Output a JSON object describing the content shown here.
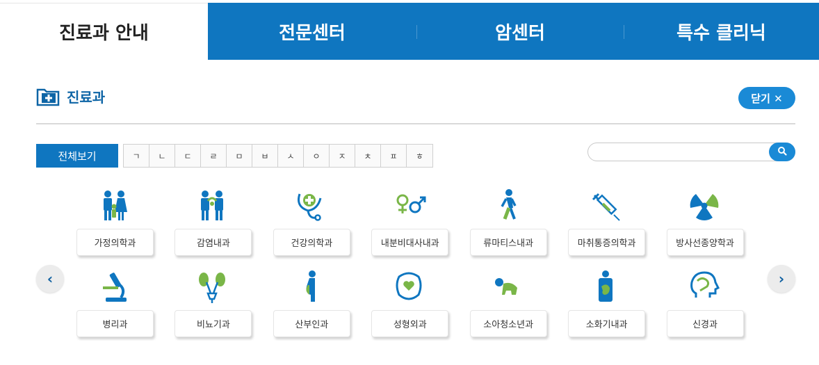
{
  "tabs": [
    {
      "label": "진료과 안내",
      "active": true
    },
    {
      "label": "전문센터",
      "active": false
    },
    {
      "label": "암센터",
      "active": false
    },
    {
      "label": "특수 클리닉",
      "active": false
    }
  ],
  "section": {
    "title": "진료과",
    "close_label": "닫기 ✕"
  },
  "filter": {
    "all_label": "전체보기",
    "consonants": [
      "ㄱ",
      "ㄴ",
      "ㄷ",
      "ㄹ",
      "ㅁ",
      "ㅂ",
      "ㅅ",
      "ㅇ",
      "ㅈ",
      "ㅊ",
      "ㅍ",
      "ㅎ"
    ]
  },
  "search": {
    "value": "",
    "placeholder": ""
  },
  "nav": {
    "prev": "‹",
    "next": "›"
  },
  "departments": {
    "row1": [
      {
        "label": "가정의학과",
        "icon": "family-icon"
      },
      {
        "label": "감염내과",
        "icon": "infection-icon"
      },
      {
        "label": "건강의학과",
        "icon": "stethoscope-icon"
      },
      {
        "label": "내분비대사내과",
        "icon": "gender-symbols-icon"
      },
      {
        "label": "류마티스내과",
        "icon": "walking-person-icon"
      },
      {
        "label": "마취통증의학과",
        "icon": "syringe-icon"
      },
      {
        "label": "방사선종양학과",
        "icon": "radiation-icon"
      }
    ],
    "row2": [
      {
        "label": "병리과",
        "icon": "microscope-icon"
      },
      {
        "label": "비뇨기과",
        "icon": "kidney-icon"
      },
      {
        "label": "산부인과",
        "icon": "pregnant-icon"
      },
      {
        "label": "성형외과",
        "icon": "face-heart-icon"
      },
      {
        "label": "소아청소년과",
        "icon": "crawling-baby-icon"
      },
      {
        "label": "소화기내과",
        "icon": "digestive-icon"
      },
      {
        "label": "신경과",
        "icon": "brain-head-icon"
      }
    ]
  },
  "colors": {
    "primary": "#0f76c0",
    "accent": "#1a8ad6",
    "green": "#7ab648"
  }
}
